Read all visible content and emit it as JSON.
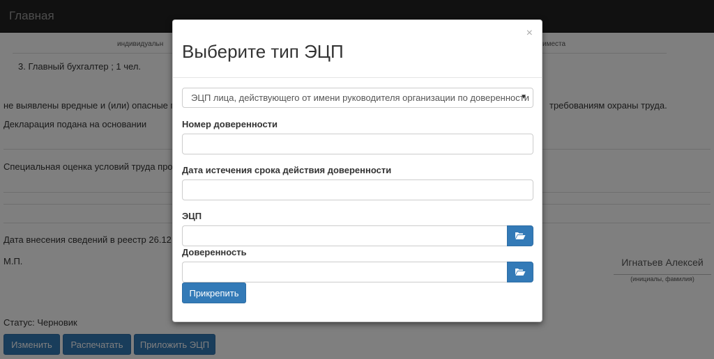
{
  "navbar": {
    "brand": "Главная"
  },
  "background": {
    "header_left": "индивидуальн",
    "header_right": "иместа",
    "line_position": "3. Главный бухгалтер ; 1 чел.",
    "line_hazards_left": "не выявлены вредные и (или) опасные п",
    "line_hazards_right": "требованиям охраны труда.",
    "line_declaration": "Декларация подана на основании",
    "line_assessment": "Специальная оценка условий труда про",
    "line_registry": "Дата внесения сведений в реестр 26.12.",
    "line_mp": "М.П.",
    "signature_name": "Игнатьев Алексей",
    "signature_caption": "(инициалы, фамилия)",
    "status": "Статус: Черновик",
    "buttons": {
      "edit": "Изменить",
      "print": "Распечатать",
      "attach_ecp": "Приложить ЭЦП"
    }
  },
  "modal": {
    "close": "×",
    "title": "Выберите тип ЭЦП",
    "select_value": "ЭЦП лица, действующего от имени руководителя организации по доверенности",
    "fields": {
      "power_number_label": "Номер доверенности",
      "power_expiry_label": "Дата истечения срока действия доверенности",
      "ecp_label": "ЭЦП",
      "power_file_label": "Доверенность"
    },
    "submit": "Прикрепить"
  },
  "colors": {
    "primary": "#337ab7",
    "navbar": "#222222"
  },
  "icons": {
    "file_browse": "folder-open-icon",
    "select_caret": "caret-down-icon"
  }
}
